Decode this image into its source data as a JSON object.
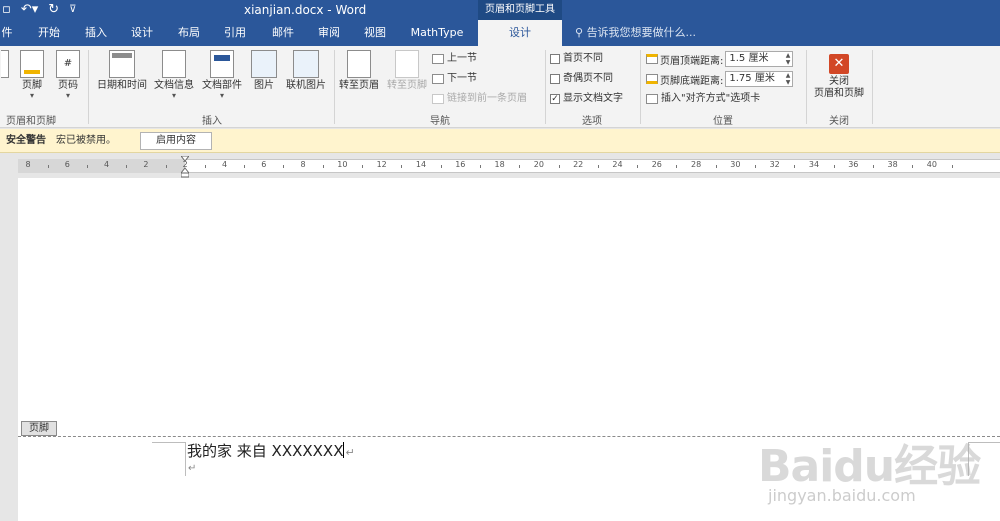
{
  "window": {
    "doc_title": "xianjian.docx - Word",
    "context_title": "页眉和页脚工具"
  },
  "qat": {
    "undo_icon": "undo-icon",
    "redo_icon": "redo-icon",
    "customize_icon": "customize-qat-icon"
  },
  "tabs": [
    {
      "label": "件"
    },
    {
      "label": "开始"
    },
    {
      "label": "插入"
    },
    {
      "label": "设计"
    },
    {
      "label": "布局"
    },
    {
      "label": "引用"
    },
    {
      "label": "邮件"
    },
    {
      "label": "审阅"
    },
    {
      "label": "视图"
    },
    {
      "label": "MathType"
    },
    {
      "label": "设计"
    }
  ],
  "tell_me": "告诉我您想要做什么...",
  "ribbon": {
    "group_header_footer": {
      "label": "页眉和页脚",
      "footer_btn": "页脚",
      "page_number_btn": "页码"
    },
    "group_insert": {
      "label": "插入",
      "date_time_btn": "日期和时间",
      "doc_info_btn": "文档信息",
      "quick_parts_btn": "文档部件",
      "picture_btn": "图片",
      "online_picture_btn": "联机图片"
    },
    "group_navigation": {
      "label": "导航",
      "goto_header_btn": "转至页眉",
      "goto_footer_btn": "转至页脚",
      "prev_btn": "上一节",
      "next_btn": "下一节",
      "link_prev_btn": "链接到前一条页眉"
    },
    "group_options": {
      "label": "选项",
      "diff_first_page": "首页不同",
      "diff_odd_even": "奇偶页不同",
      "show_doc_text": "显示文档文字",
      "show_doc_text_checked": "✓"
    },
    "group_position": {
      "label": "位置",
      "header_from_top_label": "页眉顶端距离:",
      "header_from_top_value": "1.5 厘米",
      "footer_from_bottom_label": "页脚底端距离:",
      "footer_from_bottom_value": "1.75 厘米",
      "insert_align_tab": "插入\"对齐方式\"选项卡"
    },
    "group_close": {
      "label": "关闭",
      "close_btn_line1": "关闭",
      "close_btn_line2": "页眉和页脚"
    }
  },
  "security_bar": {
    "title": "安全警告",
    "message": "宏已被禁用。",
    "enable_button": "启用内容"
  },
  "ruler": {
    "numbers": [
      "8",
      "6",
      "4",
      "2",
      "2",
      "4",
      "6",
      "8",
      "10",
      "12",
      "14",
      "16",
      "18",
      "20",
      "22",
      "24",
      "26",
      "28",
      "30",
      "32",
      "34",
      "36",
      "38",
      "40"
    ]
  },
  "document": {
    "footer_tag": "页脚",
    "footer_text": "我的家  来自 XXXXXXX",
    "para_mark": "↵"
  },
  "watermark": {
    "logo": "Baidu经验",
    "url": "jingyan.baidu.com"
  }
}
